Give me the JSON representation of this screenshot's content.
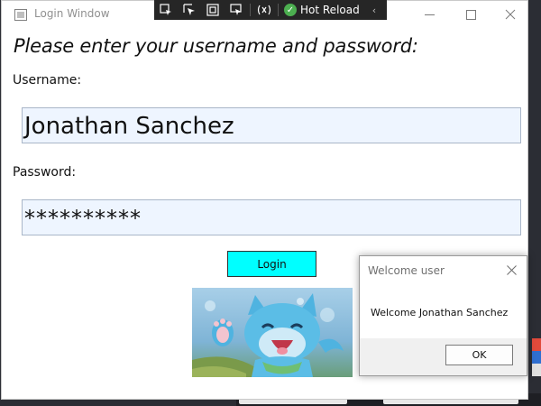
{
  "window": {
    "title": "Login Window",
    "prompt": "Please enter your username and password:"
  },
  "devbar": {
    "hot_reload_label": "Hot Reload",
    "icons": [
      "select-element-icon",
      "element-picker-icon",
      "layout-adorner-icon",
      "track-focus-icon",
      "binding-failures-icon",
      "hot-reload-check-icon",
      "collapse-arrow-icon"
    ]
  },
  "form": {
    "username_label": "Username:",
    "username_value": "Jonathan Sanchez",
    "password_label": "Password:",
    "password_value": "**********",
    "login_label": "Login",
    "login_color": "#00ffff"
  },
  "dialog": {
    "title": "Welcome user",
    "message": "Welcome Jonathan Sanchez",
    "ok_label": "OK"
  }
}
